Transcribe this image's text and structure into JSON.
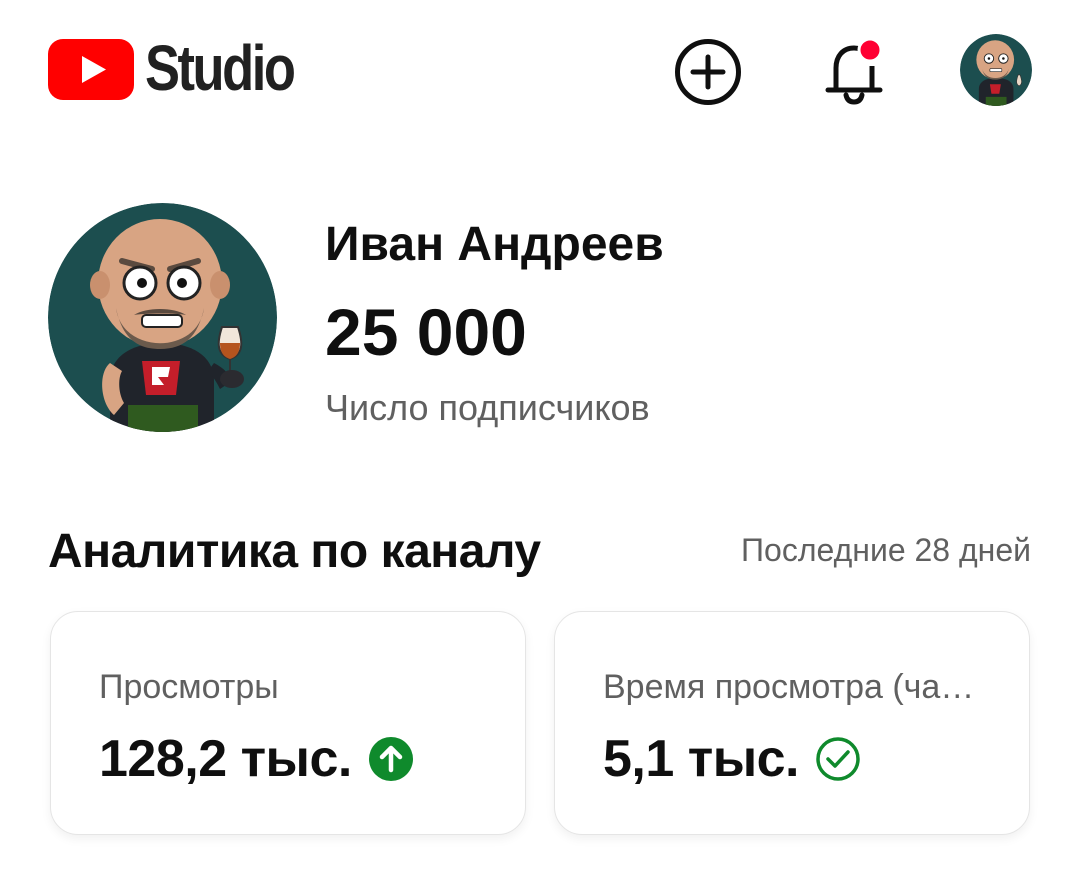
{
  "app": {
    "brand_text": "Studio",
    "icons": {
      "logo": "youtube-play-logo",
      "create": "create-plus-icon",
      "notifications": "bell-icon",
      "notification_dot_color": "#ff0033",
      "account": "avatar"
    }
  },
  "channel": {
    "name": "Иван Андреев",
    "subscribers": "25 000",
    "subscribers_label": "Число подписчиков"
  },
  "analytics": {
    "title": "Аналитика по каналу",
    "period": "Последние 28 дней",
    "cards": [
      {
        "label": "Просмотры",
        "value": "128,2 тыс.",
        "status_icon": "arrow-up-circle-icon",
        "status_color": "#0f8a2c"
      },
      {
        "label": "Время просмотра (часы)",
        "value": "5,1 тыс.",
        "status_icon": "check-circle-icon",
        "status_color": "#0f8a2c"
      }
    ]
  },
  "colors": {
    "brand_red": "#ff0000",
    "text_primary": "#0f0f0f",
    "text_secondary": "#606060",
    "avatar_bg": "#1c4e4f"
  }
}
